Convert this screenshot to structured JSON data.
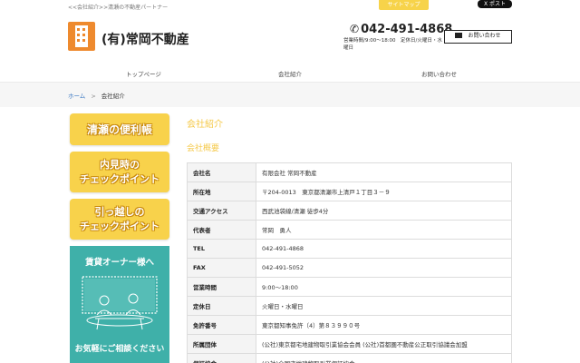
{
  "header": {
    "tagline": "<<会社紹介>>清瀬の不動産パートナー",
    "sitemap_label": "サイトマップ",
    "x_post_label": "X ポスト",
    "site_title": "(有)常岡不動産",
    "phone": "042-491-4868",
    "hours": "営業時間/9:00～18:00　定休日/火曜日・水曜日",
    "inquiry_label": "お問い合わせ"
  },
  "nav": {
    "items": [
      {
        "label": "トップページ"
      },
      {
        "label": "会社紹介"
      },
      {
        "label": "お問い合わせ"
      }
    ]
  },
  "breadcrumb": {
    "home": "ホーム",
    "separator": ">",
    "current": "会社紹介"
  },
  "sidebar": {
    "banner1": {
      "line1": "清瀬の便利帳"
    },
    "banner2": {
      "line1": "内見時の",
      "line2": "チェックポイント"
    },
    "banner3": {
      "line1": "引っ越しの",
      "line2": "チェックポイント"
    },
    "owner": {
      "title": "賃貸オーナー様へ",
      "cta": "お気軽にご相談ください"
    }
  },
  "main": {
    "section_title": "会社紹介",
    "section_sub": "会社概要",
    "rows": [
      {
        "k": "会社名",
        "v": "有限会社 常岡不動産"
      },
      {
        "k": "所在地",
        "v": "〒204-0013　東京都清瀬市上清戸１丁目３－９"
      },
      {
        "k": "交通アクセス",
        "v": "西武池袋線/清瀬 徒歩4分"
      },
      {
        "k": "代表者",
        "v": "常岡　勇人"
      },
      {
        "k": "TEL",
        "v": "042-491-4868"
      },
      {
        "k": "FAX",
        "v": "042-491-5052"
      },
      {
        "k": "営業時間",
        "v": "9:00～18:00"
      },
      {
        "k": "定休日",
        "v": "火曜日・水曜日"
      },
      {
        "k": "免許番号",
        "v": "東京都知事免許（4）第８３９９０号"
      },
      {
        "k": "所属団体",
        "v": "(公社)東京都宅地建物取引業協会会員 (公社)首都圏不動産公正取引協議会加盟"
      },
      {
        "k": "保証協会",
        "v": "(公社)全国宅地建物取引業保証協会"
      }
    ]
  },
  "colors": {
    "accent_yellow": "#f8d24b",
    "logo_orange": "#ee8a2e",
    "owner_teal": "#3fb0a9",
    "link_blue": "#3a78c2"
  }
}
